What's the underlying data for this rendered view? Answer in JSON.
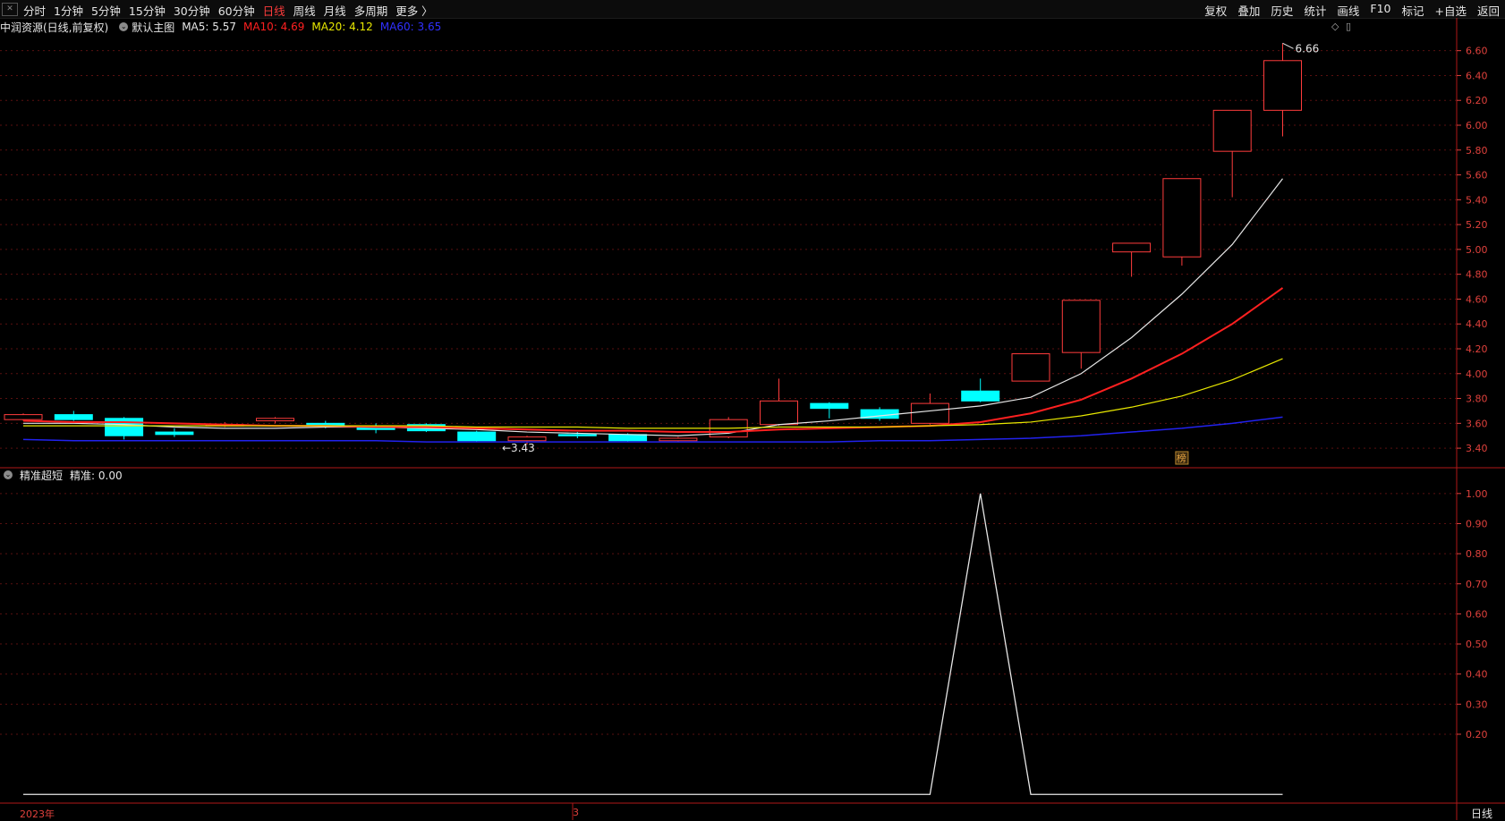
{
  "toolbar": {
    "tabs": [
      "分时",
      "1分钟",
      "5分钟",
      "15分钟",
      "30分钟",
      "60分钟",
      "日线",
      "周线",
      "月线",
      "多周期",
      "更多 〉"
    ],
    "active_tab": "日线",
    "right_tools": [
      "复权",
      "叠加",
      "历史",
      "统计",
      "画线",
      "F10",
      "标记",
      "+自选",
      "返回"
    ]
  },
  "main_panel": {
    "stock_label": "中润资源(日线,前复权)",
    "chart_label": "默认主图",
    "indicators": [
      {
        "label": "MA5: 5.57",
        "color": "#e6e6e6"
      },
      {
        "label": "MA10: 4.69",
        "color": "#ff2020"
      },
      {
        "label": "MA20: 4.12",
        "color": "#e8e800"
      },
      {
        "label": "MA60: 3.65",
        "color": "#3030ff"
      }
    ],
    "high_mark": "6.66",
    "low_mark": "3.43",
    "badge": "榜"
  },
  "sub_panel": {
    "indicator_name": "精准超短",
    "value_label": "精准: 0.00"
  },
  "x_axis": {
    "labels": [
      "2023年",
      "3"
    ]
  },
  "period_label": "日线",
  "colors": {
    "up": "#ff3c3c",
    "down": "#00ffff",
    "ma5": "#e6e6e6",
    "ma10": "#ff2020",
    "ma20": "#e8e800",
    "ma60": "#2222ee",
    "grid": "#5a1010",
    "axis": "#e0413c"
  },
  "chart_data": [
    {
      "type": "candlestick",
      "y_ticks": [
        3.4,
        3.6,
        3.8,
        4.0,
        4.2,
        4.4,
        4.6,
        4.8,
        5.0,
        5.2,
        5.4,
        5.6,
        5.8,
        6.0,
        6.2,
        6.4,
        6.6
      ],
      "ylim": [
        3.3,
        6.72
      ],
      "candles": [
        {
          "o": 3.63,
          "c": 3.67,
          "h": 3.68,
          "l": 3.62
        },
        {
          "o": 3.67,
          "c": 3.63,
          "h": 3.7,
          "l": 3.62
        },
        {
          "o": 3.64,
          "c": 3.5,
          "h": 3.65,
          "l": 3.47
        },
        {
          "o": 3.53,
          "c": 3.51,
          "h": 3.56,
          "l": 3.49
        },
        {
          "o": 3.58,
          "c": 3.59,
          "h": 3.61,
          "l": 3.57
        },
        {
          "o": 3.62,
          "c": 3.64,
          "h": 3.65,
          "l": 3.6
        },
        {
          "o": 3.6,
          "c": 3.58,
          "h": 3.62,
          "l": 3.56
        },
        {
          "o": 3.57,
          "c": 3.55,
          "h": 3.6,
          "l": 3.52
        },
        {
          "o": 3.59,
          "c": 3.54,
          "h": 3.6,
          "l": 3.53
        },
        {
          "o": 3.53,
          "c": 3.46,
          "h": 3.54,
          "l": 3.45
        },
        {
          "o": 3.46,
          "c": 3.49,
          "h": 3.5,
          "l": 3.43
        },
        {
          "o": 3.51,
          "c": 3.5,
          "h": 3.53,
          "l": 3.48
        },
        {
          "o": 3.51,
          "c": 3.46,
          "h": 3.52,
          "l": 3.45
        },
        {
          "o": 3.46,
          "c": 3.48,
          "h": 3.49,
          "l": 3.45
        },
        {
          "o": 3.49,
          "c": 3.63,
          "h": 3.65,
          "l": 3.48
        },
        {
          "o": 3.59,
          "c": 3.78,
          "h": 3.96,
          "l": 3.58
        },
        {
          "o": 3.76,
          "c": 3.72,
          "h": 3.77,
          "l": 3.64
        },
        {
          "o": 3.71,
          "c": 3.64,
          "h": 3.73,
          "l": 3.62
        },
        {
          "o": 3.6,
          "c": 3.76,
          "h": 3.84,
          "l": 3.59
        },
        {
          "o": 3.86,
          "c": 3.78,
          "h": 3.96,
          "l": 3.77
        },
        {
          "o": 3.94,
          "c": 4.16,
          "h": 4.16,
          "l": 3.94
        },
        {
          "o": 4.17,
          "c": 4.59,
          "h": 4.59,
          "l": 4.04
        },
        {
          "o": 4.98,
          "c": 5.05,
          "h": 5.05,
          "l": 4.78
        },
        {
          "o": 4.94,
          "c": 5.57,
          "h": 5.57,
          "l": 4.87
        },
        {
          "o": 5.79,
          "c": 6.12,
          "h": 6.12,
          "l": 5.42
        },
        {
          "o": 6.12,
          "c": 6.52,
          "h": 6.66,
          "l": 5.91
        }
      ],
      "series": [
        {
          "name": "MA5",
          "values": [
            3.6,
            3.6,
            3.59,
            3.57,
            3.56,
            3.56,
            3.57,
            3.57,
            3.56,
            3.55,
            3.53,
            3.52,
            3.51,
            3.5,
            3.52,
            3.59,
            3.62,
            3.66,
            3.7,
            3.74,
            3.81,
            4.0,
            4.29,
            4.64,
            5.04,
            5.57
          ]
        },
        {
          "name": "MA10",
          "values": [
            3.62,
            3.61,
            3.61,
            3.6,
            3.59,
            3.58,
            3.58,
            3.57,
            3.57,
            3.56,
            3.55,
            3.54,
            3.54,
            3.53,
            3.53,
            3.55,
            3.56,
            3.57,
            3.58,
            3.61,
            3.68,
            3.79,
            3.96,
            4.16,
            4.4,
            4.69
          ]
        },
        {
          "name": "MA20",
          "values": [
            3.58,
            3.58,
            3.58,
            3.58,
            3.58,
            3.58,
            3.58,
            3.58,
            3.58,
            3.57,
            3.57,
            3.57,
            3.56,
            3.56,
            3.56,
            3.57,
            3.57,
            3.57,
            3.58,
            3.59,
            3.61,
            3.66,
            3.73,
            3.82,
            3.95,
            4.12
          ]
        },
        {
          "name": "MA60",
          "values": [
            3.47,
            3.46,
            3.46,
            3.46,
            3.46,
            3.46,
            3.46,
            3.46,
            3.45,
            3.45,
            3.45,
            3.45,
            3.45,
            3.45,
            3.45,
            3.45,
            3.45,
            3.46,
            3.46,
            3.47,
            3.48,
            3.5,
            3.53,
            3.56,
            3.6,
            3.65
          ]
        }
      ]
    },
    {
      "type": "line",
      "y_ticks": [
        0.2,
        0.3,
        0.4,
        0.5,
        0.6,
        0.7,
        0.8,
        0.9,
        1.0
      ],
      "ylim": [
        -0.02,
        1.05
      ],
      "series": [
        {
          "name": "精准",
          "values": [
            0,
            0,
            0,
            0,
            0,
            0,
            0,
            0,
            0,
            0,
            0,
            0,
            0,
            0,
            0,
            0,
            0,
            0,
            0,
            1,
            0,
            0,
            0,
            0,
            0,
            0
          ]
        }
      ]
    }
  ]
}
